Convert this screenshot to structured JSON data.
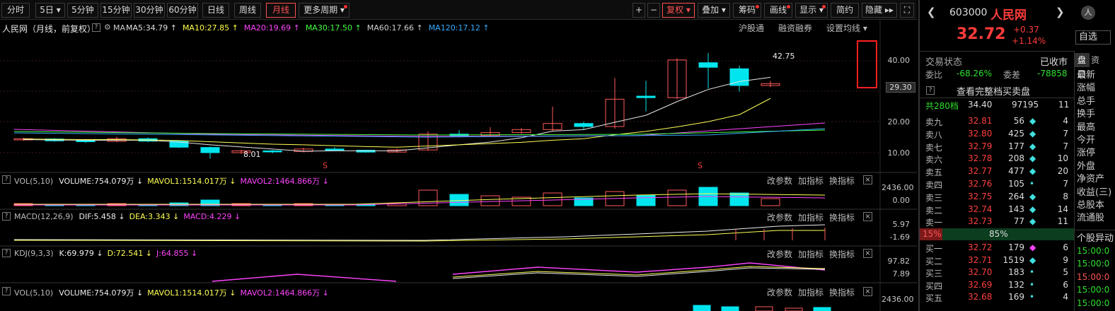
{
  "toolbar": {
    "periods": [
      "分时",
      "5日",
      "5分钟",
      "15分钟",
      "30分钟",
      "60分钟",
      "日线",
      "周线",
      "月线",
      "更多周期"
    ],
    "tools": [
      "+",
      "−",
      "复权",
      "叠加",
      "筹码",
      "画线",
      "显示",
      "简约",
      "隐藏"
    ],
    "more_arrows": "▸▸",
    "fullscreen": "⛶"
  },
  "stock": {
    "code": "603000",
    "name": "人民网",
    "price": "32.72",
    "change": "+0.37",
    "pct": "+1.14%"
  },
  "chart_header": {
    "title": "人民网（月线，前复权）",
    "ma_label": "MA",
    "ma_values": [
      "MA5:34.79",
      "MA10:27.85",
      "MA20:19.69",
      "MA30:17.50",
      "MA60:17.66",
      "MA120:17.12"
    ],
    "ma_colors": [
      "#e0e0e0",
      "#ffff44",
      "#ff44ff",
      "#44ff44",
      "#cccccc",
      "#33aaff"
    ],
    "links": [
      "沪股通",
      "融资融券",
      "设置均线"
    ]
  },
  "price_axis": {
    "labels": [
      "40.00",
      "29.30",
      "20.00",
      "10.00"
    ],
    "current": "29.30"
  },
  "annotations": {
    "high": "42.75",
    "low": "8.01",
    "s_marker": "S"
  },
  "panels": [
    {
      "id": "vol",
      "name": "VOL(5,10)",
      "items": [
        "VOLUME:754.079万",
        "MAVOL1:1514.017万",
        "MAVOL2:1464.866万"
      ],
      "axis": [
        "2436.00",
        "0.00"
      ]
    },
    {
      "id": "macd",
      "name": "MACD(12,26,9)",
      "items": [
        "DIF:5.458",
        "DEA:3.343",
        "MACD:4.229"
      ],
      "axis": [
        "5.97",
        "-1.69"
      ]
    },
    {
      "id": "kdj",
      "name": "KDJ(9,3,3)",
      "items": [
        "K:69.979",
        "D:72.541",
        "J:64.855"
      ],
      "axis": [
        "97.82",
        "7.89"
      ]
    },
    {
      "id": "vol2",
      "name": "VOL(5,10)",
      "items": [
        "VOLUME:754.079万",
        "MAVOL1:1514.017万",
        "MAVOL2:1464.866万"
      ],
      "axis": [
        "2436.00"
      ]
    }
  ],
  "panel_buttons": [
    "改参数",
    "加指标",
    "换指标"
  ],
  "panel_close": "×",
  "panel_help": "?",
  "right_panel": {
    "trade_status_label": "交易状态",
    "trade_status": "已收市",
    "weibi_label": "委比",
    "weibi": "-68.26%",
    "weicha_label": "委差",
    "weicha": "-78858",
    "full_book": "查看完整档买卖盘",
    "total_label": "共280档",
    "total_price": "34.40",
    "total_vol": "97195",
    "total_count": "11",
    "ask_labels": [
      "卖九",
      "卖八",
      "卖七",
      "卖六",
      "卖五",
      "卖四",
      "卖三",
      "卖二",
      "卖一"
    ],
    "asks": [
      [
        "32.81",
        "56",
        "4"
      ],
      [
        "32.80",
        "425",
        "7"
      ],
      [
        "32.79",
        "177",
        "7"
      ],
      [
        "32.78",
        "208",
        "10"
      ],
      [
        "32.77",
        "477",
        "20"
      ],
      [
        "32.76",
        "105",
        "7"
      ],
      [
        "32.75",
        "264",
        "8"
      ],
      [
        "32.74",
        "143",
        "14"
      ],
      [
        "32.73",
        "77",
        "11"
      ]
    ],
    "ratio_left": "15%",
    "ratio_right": "85%",
    "bid_labels": [
      "买一",
      "买二",
      "买三",
      "买四",
      "买五"
    ],
    "bids": [
      [
        "32.72",
        "179",
        "6"
      ],
      [
        "32.71",
        "1519",
        "9"
      ],
      [
        "32.70",
        "183",
        "5"
      ],
      [
        "32.69",
        "132",
        "6"
      ],
      [
        "32.68",
        "169",
        "4"
      ]
    ],
    "side_tabs": [
      "盘口",
      "资"
    ],
    "side_items": [
      "最新",
      "涨幅",
      "总手",
      "换手",
      "最高",
      "今开",
      "涨停",
      "外盘",
      "净资产",
      "收益(三)",
      "总股本",
      "流通股"
    ],
    "abnormal_label": "个股异动",
    "times": [
      "15:00:0",
      "15:00:0",
      "15:00:0",
      "15:00:0",
      "15:00:0"
    ],
    "zixuan": "自选",
    "avatar": "人"
  },
  "chart_data": {
    "type": "candlestick",
    "period": "monthly",
    "candles": [
      {
        "o": 14.2,
        "c": 14.6,
        "h": 14.9,
        "l": 13.9
      },
      {
        "o": 14.5,
        "c": 13.9,
        "h": 14.8,
        "l": 13.6
      },
      {
        "o": 14.0,
        "c": 13.6,
        "h": 14.3,
        "l": 13.2
      },
      {
        "o": 13.7,
        "c": 14.6,
        "h": 15.2,
        "l": 13.5
      },
      {
        "o": 14.6,
        "c": 13.8,
        "h": 15.0,
        "l": 13.5
      },
      {
        "o": 13.8,
        "c": 11.8,
        "h": 13.9,
        "l": 11.5
      },
      {
        "o": 11.7,
        "c": 10.0,
        "h": 12.0,
        "l": 8.01
      },
      {
        "o": 10.0,
        "c": 10.6,
        "h": 11.0,
        "l": 9.6
      },
      {
        "o": 10.6,
        "c": 10.3,
        "h": 10.9,
        "l": 9.8
      },
      {
        "o": 10.4,
        "c": 11.2,
        "h": 11.6,
        "l": 10.1
      },
      {
        "o": 11.2,
        "c": 10.8,
        "h": 11.8,
        "l": 10.6
      },
      {
        "o": 10.8,
        "c": 10.2,
        "h": 11.0,
        "l": 10.0
      },
      {
        "o": 10.2,
        "c": 10.9,
        "h": 11.3,
        "l": 10.0
      },
      {
        "o": 10.9,
        "c": 16.1,
        "h": 17.0,
        "l": 10.6
      },
      {
        "o": 16.1,
        "c": 15.6,
        "h": 17.4,
        "l": 15.1
      },
      {
        "o": 15.6,
        "c": 16.6,
        "h": 18.4,
        "l": 15.4
      },
      {
        "o": 16.6,
        "c": 17.6,
        "h": 18.1,
        "l": 16.2
      },
      {
        "o": 17.6,
        "c": 19.6,
        "h": 25.2,
        "l": 17.1
      },
      {
        "o": 19.6,
        "c": 18.6,
        "h": 20.2,
        "l": 17.6
      },
      {
        "o": 18.6,
        "c": 27.6,
        "h": 34.6,
        "l": 17.9
      },
      {
        "o": 28.6,
        "c": 28.1,
        "h": 33.6,
        "l": 23.6
      },
      {
        "o": 28.1,
        "c": 40.5,
        "h": 41.1,
        "l": 27.6
      },
      {
        "o": 39.6,
        "c": 38.1,
        "h": 42.75,
        "l": 31.1
      },
      {
        "o": 37.6,
        "c": 32.1,
        "h": 38.6,
        "l": 30.1
      },
      {
        "o": 32.1,
        "c": 32.72,
        "h": 33.6,
        "l": 31.6
      }
    ],
    "ma_lines": [
      {
        "name": "MA5",
        "values": [
          14.3,
          14.2,
          14.1,
          14.1,
          14.1,
          13.5,
          12.6,
          11.9,
          11.2,
          10.5,
          10.6,
          10.6,
          10.6,
          11.6,
          12.6,
          13.5,
          14.9,
          17.1,
          17.6,
          20.0,
          22.3,
          26.8,
          30.8,
          33.4,
          34.79
        ]
      },
      {
        "name": "MA10",
        "values": [
          14.5,
          14.4,
          14.3,
          14.3,
          14.2,
          14.0,
          13.6,
          13.2,
          12.8,
          12.6,
          12.3,
          12.0,
          11.8,
          12.2,
          12.6,
          13.0,
          13.4,
          14.1,
          14.6,
          15.9,
          17.0,
          18.5,
          20.2,
          22.5,
          27.85
        ]
      }
    ]
  }
}
